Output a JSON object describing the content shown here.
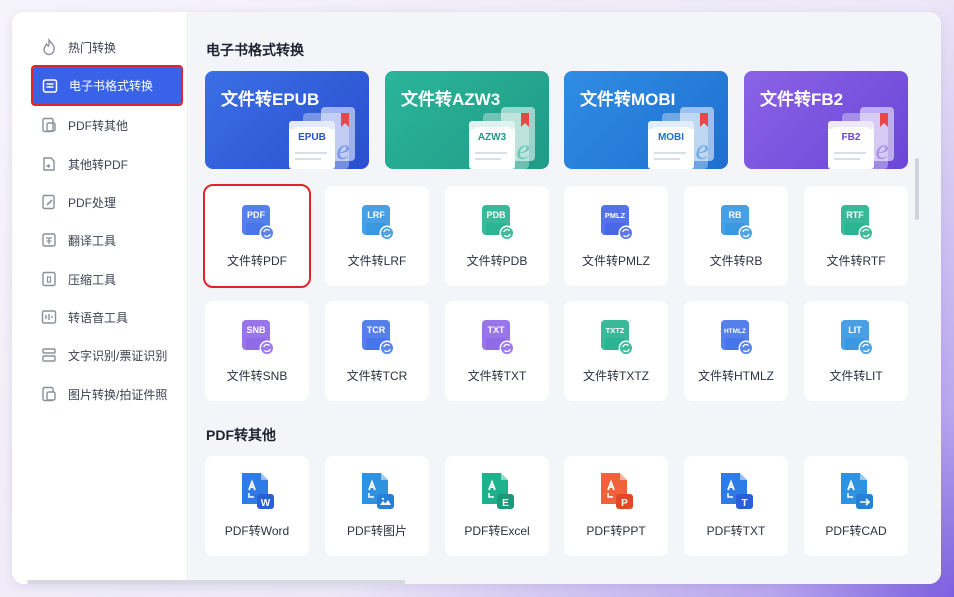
{
  "sidebar": {
    "items": [
      {
        "label": "热门转换",
        "icon": "flame-icon",
        "active": false
      },
      {
        "label": "电子书格式转换",
        "icon": "ebook-icon",
        "active": true
      },
      {
        "label": "PDF转其他",
        "icon": "pdf-export-icon",
        "active": false
      },
      {
        "label": "其他转PDF",
        "icon": "to-pdf-icon",
        "active": false
      },
      {
        "label": "PDF处理",
        "icon": "pdf-edit-icon",
        "active": false
      },
      {
        "label": "翻译工具",
        "icon": "translate-icon",
        "active": false
      },
      {
        "label": "压缩工具",
        "icon": "compress-icon",
        "active": false
      },
      {
        "label": "转语音工具",
        "icon": "speech-icon",
        "active": false
      },
      {
        "label": "文字识别/票证识别",
        "icon": "ocr-icon",
        "active": false
      },
      {
        "label": "图片转换/拍证件照",
        "icon": "image-convert-icon",
        "active": false
      }
    ]
  },
  "ebook_section": {
    "title": "电子书格式转换",
    "banners": [
      {
        "title": "文件转EPUB",
        "tag": "EPUB",
        "color_a": "#3b6fe6",
        "color_b": "#2a4fcf"
      },
      {
        "title": "文件转AZW3",
        "tag": "AZW3",
        "color_a": "#2bb59a",
        "color_b": "#1f9a86"
      },
      {
        "title": "文件转MOBI",
        "tag": "MOBI",
        "color_a": "#2f8de4",
        "color_b": "#1f6fd0"
      },
      {
        "title": "文件转FB2",
        "tag": "FB2",
        "color_a": "#8a62e6",
        "color_b": "#6b47d6"
      }
    ],
    "tiles": [
      {
        "label": "文件转PDF",
        "tag": "PDF",
        "color": "#3e6ee8"
      },
      {
        "label": "文件转LRF",
        "tag": "LRF",
        "color": "#2f92e0"
      },
      {
        "label": "文件转PDB",
        "tag": "PDB",
        "color": "#1fb08c"
      },
      {
        "label": "文件转PMLZ",
        "tag": "PMLZ",
        "color": "#3e5fe6"
      },
      {
        "label": "文件转RB",
        "tag": "RB",
        "color": "#2f92e0"
      },
      {
        "label": "文件转RTF",
        "tag": "RTF",
        "color": "#1fb08c"
      },
      {
        "label": "文件转SNB",
        "tag": "SNB",
        "color": "#8a62e6"
      },
      {
        "label": "文件转TCR",
        "tag": "TCR",
        "color": "#3e6ee8"
      },
      {
        "label": "文件转TXT",
        "tag": "TXT",
        "color": "#8a62e6"
      },
      {
        "label": "文件转TXTZ",
        "tag": "TXTZ",
        "color": "#1fb08c"
      },
      {
        "label": "文件转HTMLZ",
        "tag": "HTMLZ",
        "color": "#3e6ee8"
      },
      {
        "label": "文件转LIT",
        "tag": "LIT",
        "color": "#2f92e0"
      }
    ]
  },
  "pdf_section": {
    "title": "PDF转其他",
    "tiles": [
      {
        "label": "PDF转Word",
        "badge": "W",
        "color": "#2f7be6",
        "badge_color": "#2a5fd8"
      },
      {
        "label": "PDF转图片",
        "badge": "img",
        "color": "#2f92e0",
        "badge_color": "#2580d6"
      },
      {
        "label": "PDF转Excel",
        "badge": "E",
        "color": "#1fb08c",
        "badge_color": "#1a9a78"
      },
      {
        "label": "PDF转PPT",
        "badge": "P",
        "color": "#f0623c",
        "badge_color": "#e0482a"
      },
      {
        "label": "PDF转TXT",
        "badge": "T",
        "color": "#2f7be6",
        "badge_color": "#2a5fd8"
      },
      {
        "label": "PDF转CAD",
        "badge": "cad",
        "color": "#2f92e0",
        "badge_color": "#2580d6"
      }
    ]
  }
}
